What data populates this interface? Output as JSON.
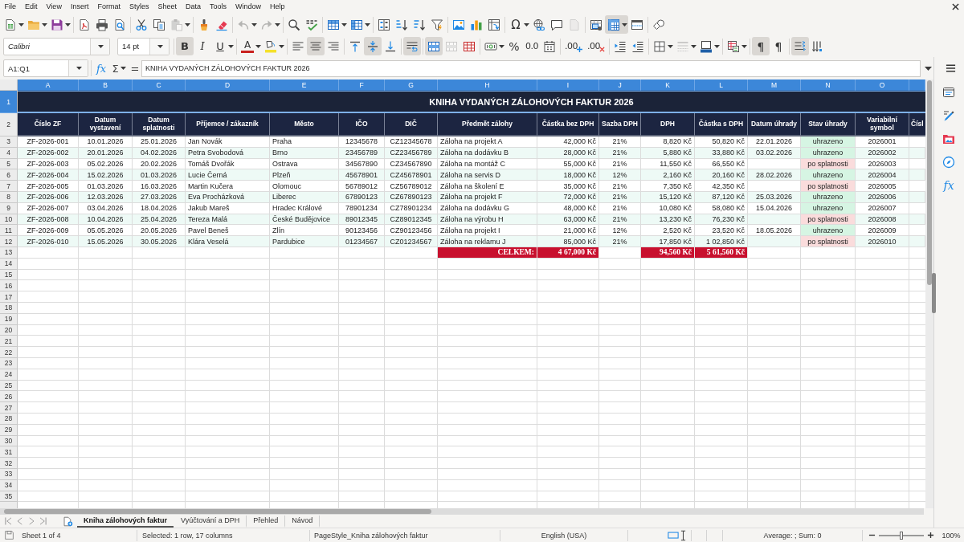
{
  "menu_bar": [
    "File",
    "Edit",
    "View",
    "Insert",
    "Format",
    "Styles",
    "Sheet",
    "Data",
    "Tools",
    "Window",
    "Help"
  ],
  "standard_toolbar": [
    {
      "on": false,
      "disabled": false
    },
    {
      "on": false,
      "disabled": false
    },
    {
      "on": false,
      "disabled": false
    },
    {
      "on": false,
      "disabled": false
    },
    {
      "on": false,
      "disabled": false
    },
    {
      "on": false,
      "disabled": false
    },
    {
      "on": false,
      "disabled": false
    },
    {
      "on": false,
      "disabled": false
    },
    {
      "on": false,
      "disabled": true
    },
    {
      "on": false,
      "disabled": false
    },
    {
      "on": false,
      "disabled": false
    },
    {
      "on": false,
      "disabled": true
    },
    {
      "on": false,
      "disabled": true
    },
    {
      "on": false,
      "disabled": false
    },
    {
      "on": false,
      "disabled": false
    },
    {
      "on": false,
      "disabled": false
    },
    {
      "on": false,
      "disabled": false
    },
    {
      "on": false,
      "disabled": false
    },
    {
      "on": false,
      "disabled": false
    },
    {
      "on": false,
      "disabled": false
    },
    {
      "on": false,
      "disabled": false
    },
    {
      "on": false,
      "disabled": false
    },
    {
      "on": false,
      "disabled": false
    },
    {
      "on": false,
      "disabled": false
    },
    {
      "glyph": "Ω",
      "on": false,
      "disabled": false
    },
    {
      "on": false,
      "disabled": false
    },
    {
      "on": false,
      "disabled": false
    },
    {
      "on": false,
      "disabled": true
    },
    {
      "on": false,
      "disabled": false
    },
    {
      "on": true,
      "disabled": false
    },
    {
      "on": false,
      "disabled": false
    },
    {
      "on": false,
      "disabled": false
    }
  ],
  "formatting_toolbar": {
    "font_name": "Calibri",
    "font_size": "14 pt",
    "buttons": [
      {
        "glyph": "B",
        "on": true,
        "disabled": false
      },
      {
        "glyph": "I",
        "on": false,
        "disabled": false
      },
      {
        "glyph": "U",
        "on": false,
        "disabled": false
      },
      {
        "glyph": "A",
        "on": false,
        "disabled": false
      },
      {
        "on": false,
        "disabled": false
      },
      {
        "on": false,
        "disabled": false
      },
      {
        "on": true,
        "disabled": false
      },
      {
        "on": false,
        "disabled": false
      },
      {
        "on": false,
        "disabled": false
      },
      {
        "on": true,
        "disabled": false
      },
      {
        "on": false,
        "disabled": false
      },
      {
        "on": true,
        "disabled": false
      },
      {
        "on": true,
        "disabled": false
      },
      {
        "on": false,
        "disabled": true
      },
      {
        "on": false,
        "disabled": false
      },
      {
        "on": false,
        "disabled": false
      },
      {
        "glyph": "%",
        "on": false,
        "disabled": false
      },
      {
        "glyph": "0.0",
        "on": false,
        "disabled": false
      },
      {
        "on": false,
        "disabled": false
      },
      {
        "glyph": ".00",
        "on": false,
        "disabled": false
      },
      {
        "glyph": ".00",
        "on": false,
        "disabled": false
      },
      {
        "on": false,
        "disabled": false
      },
      {
        "on": false,
        "disabled": false
      },
      {
        "on": false,
        "disabled": false
      },
      {
        "on": false,
        "disabled": true
      },
      {
        "on": false,
        "disabled": false
      },
      {
        "on": false,
        "disabled": false
      },
      {
        "glyph": "¶",
        "on": true,
        "disabled": false
      },
      {
        "glyph": "¶",
        "on": false,
        "disabled": false
      },
      {
        "on": true,
        "disabled": false
      },
      {
        "on": false,
        "disabled": false
      }
    ]
  },
  "formula_bar": {
    "name_box": "A1:Q1",
    "function_wizard": "fx",
    "sum": "Σ",
    "equals": "=",
    "content": "KNIHA VYDANÝCH ZÁLOHOVÝCH FAKTUR 2026"
  },
  "sidebar": {
    "functions": "fx"
  },
  "sheet": {
    "columns": [
      {
        "letter": "A",
        "selected": true
      },
      {
        "letter": "B",
        "selected": true
      },
      {
        "letter": "C",
        "selected": true
      },
      {
        "letter": "D",
        "selected": true
      },
      {
        "letter": "E",
        "selected": true
      },
      {
        "letter": "F",
        "selected": true
      },
      {
        "letter": "G",
        "selected": true
      },
      {
        "letter": "H",
        "selected": true
      },
      {
        "letter": "I",
        "selected": true
      },
      {
        "letter": "J",
        "selected": true
      },
      {
        "letter": "K",
        "selected": true
      },
      {
        "letter": "L",
        "selected": true
      },
      {
        "letter": "M",
        "selected": true
      },
      {
        "letter": "N",
        "selected": true
      },
      {
        "letter": "O",
        "selected": true
      },
      {
        "selected": true
      }
    ],
    "row_numbers": [
      {
        "number": "1",
        "selected": true
      },
      {
        "number": "2",
        "selected": false
      },
      {
        "number": "3",
        "selected": false
      },
      {
        "number": "4",
        "selected": false
      },
      {
        "number": "5",
        "selected": false
      },
      {
        "number": "6",
        "selected": false
      },
      {
        "number": "7",
        "selected": false
      },
      {
        "number": "8",
        "selected": false
      },
      {
        "number": "9",
        "selected": false
      },
      {
        "number": "10",
        "selected": false
      },
      {
        "number": "11",
        "selected": false
      },
      {
        "number": "12",
        "selected": false
      },
      {
        "number": "13",
        "selected": false
      },
      {
        "number": "14",
        "selected": false
      },
      {
        "number": "15",
        "selected": false
      },
      {
        "number": "16",
        "selected": false
      },
      {
        "number": "17",
        "selected": false
      },
      {
        "number": "18",
        "selected": false
      },
      {
        "number": "19",
        "selected": false
      },
      {
        "number": "20",
        "selected": false
      },
      {
        "number": "21",
        "selected": false
      },
      {
        "number": "22",
        "selected": false
      },
      {
        "number": "23",
        "selected": false
      },
      {
        "number": "24",
        "selected": false
      },
      {
        "number": "25",
        "selected": false
      },
      {
        "number": "26",
        "selected": false
      },
      {
        "number": "27",
        "selected": false
      },
      {
        "number": "28",
        "selected": false
      },
      {
        "number": "29",
        "selected": false
      },
      {
        "number": "30",
        "selected": false
      },
      {
        "number": "31",
        "selected": false
      },
      {
        "number": "32",
        "selected": false
      },
      {
        "number": "33",
        "selected": false
      },
      {
        "number": "34",
        "selected": false
      },
      {
        "number": "35",
        "selected": false
      }
    ],
    "title": "KNIHA VYDANÝCH ZÁLOHOVÝCH FAKTUR 2026",
    "headers": [
      "Číslo ZF",
      "Datum vystavení",
      "Datum splatnosti",
      "Příjemce / zákazník",
      "Město",
      "IČO",
      "DIČ",
      "Předmět zálohy",
      "Částka bez DPH",
      "Sazba DPH",
      "DPH",
      "Částka s DPH",
      "Datum úhrady",
      "Stav úhrady",
      "Variabilní symbol",
      "Čísl"
    ],
    "rows": [
      {
        "cislo_zf": "ZF-2026-001",
        "datum_vystaveni": "10.01.2026",
        "datum_splatnosti": "25.01.2026",
        "prijemce": "Jan Novák",
        "mesto": "Praha",
        "ico": "12345678",
        "dic": "CZ12345678",
        "predmet": "Záloha na projekt A",
        "castka_bez_dph": "42,000 Kč",
        "sazba_dph": "21%",
        "dph": "8,820 Kč",
        "castka_s_dph": "50,820 Kč",
        "datum_uhrady": "22.01.2026",
        "stav_uhrady": {
          "text": "uhrazeno",
          "color": "#d6f5e3"
        },
        "variabilni_symbol": "2026001"
      },
      {
        "cislo_zf": "ZF-2026-002",
        "datum_vystaveni": "20.01.2026",
        "datum_splatnosti": "04.02.2026",
        "prijemce": "Petra Svobodová",
        "mesto": "Brno",
        "ico": "23456789",
        "dic": "CZ23456789",
        "predmet": "Záloha na dodávku B",
        "castka_bez_dph": "28,000 Kč",
        "sazba_dph": "21%",
        "dph": "5,880 Kč",
        "castka_s_dph": "33,880 Kč",
        "datum_uhrady": "03.02.2026",
        "stav_uhrady": {
          "text": "uhrazeno",
          "color": "#d6f5e3"
        },
        "variabilni_symbol": "2026002"
      },
      {
        "cislo_zf": "ZF-2026-003",
        "datum_vystaveni": "05.02.2026",
        "datum_splatnosti": "20.02.2026",
        "prijemce": "Tomáš Dvořák",
        "mesto": "Ostrava",
        "ico": "34567890",
        "dic": "CZ34567890",
        "predmet": "Záloha na montáž C",
        "castka_bez_dph": "55,000 Kč",
        "sazba_dph": "21%",
        "dph": "11,550 Kč",
        "castka_s_dph": "66,550 Kč",
        "stav_uhrady": {
          "text": "po splatnosti",
          "color": "#fadcdc"
        },
        "variabilni_symbol": "2026003"
      },
      {
        "cislo_zf": "ZF-2026-004",
        "datum_vystaveni": "15.02.2026",
        "datum_splatnosti": "01.03.2026",
        "prijemce": "Lucie Černá",
        "mesto": "Plzeň",
        "ico": "45678901",
        "dic": "CZ45678901",
        "predmet": "Záloha na servis D",
        "castka_bez_dph": "18,000 Kč",
        "sazba_dph": "12%",
        "dph": "2,160 Kč",
        "castka_s_dph": "20,160 Kč",
        "datum_uhrady": "28.02.2026",
        "stav_uhrady": {
          "text": "uhrazeno",
          "color": "#d6f5e3"
        },
        "variabilni_symbol": "2026004"
      },
      {
        "cislo_zf": "ZF-2026-005",
        "datum_vystaveni": "01.03.2026",
        "datum_splatnosti": "16.03.2026",
        "prijemce": "Martin Kučera",
        "mesto": "Olomouc",
        "ico": "56789012",
        "dic": "CZ56789012",
        "predmet": "Záloha na školení E",
        "castka_bez_dph": "35,000 Kč",
        "sazba_dph": "21%",
        "dph": "7,350 Kč",
        "castka_s_dph": "42,350 Kč",
        "stav_uhrady": {
          "text": "po splatnosti",
          "color": "#fadcdc"
        },
        "variabilni_symbol": "2026005"
      },
      {
        "cislo_zf": "ZF-2026-006",
        "datum_vystaveni": "12.03.2026",
        "datum_splatnosti": "27.03.2026",
        "prijemce": "Eva Procházková",
        "mesto": "Liberec",
        "ico": "67890123",
        "dic": "CZ67890123",
        "predmet": "Záloha na projekt F",
        "castka_bez_dph": "72,000 Kč",
        "sazba_dph": "21%",
        "dph": "15,120 Kč",
        "castka_s_dph": "87,120 Kč",
        "datum_uhrady": "25.03.2026",
        "stav_uhrady": {
          "text": "uhrazeno",
          "color": "#d6f5e3"
        },
        "variabilni_symbol": "2026006"
      },
      {
        "cislo_zf": "ZF-2026-007",
        "datum_vystaveni": "03.04.2026",
        "datum_splatnosti": "18.04.2026",
        "prijemce": "Jakub Mareš",
        "mesto": "Hradec Králové",
        "ico": "78901234",
        "dic": "CZ78901234",
        "predmet": "Záloha na dodávku G",
        "castka_bez_dph": "48,000 Kč",
        "sazba_dph": "21%",
        "dph": "10,080 Kč",
        "castka_s_dph": "58,080 Kč",
        "datum_uhrady": "15.04.2026",
        "stav_uhrady": {
          "text": "uhrazeno",
          "color": "#d6f5e3"
        },
        "variabilni_symbol": "2026007"
      },
      {
        "cislo_zf": "ZF-2026-008",
        "datum_vystaveni": "10.04.2026",
        "datum_splatnosti": "25.04.2026",
        "prijemce": "Tereza Malá",
        "mesto": "České Budějovice",
        "ico": "89012345",
        "dic": "CZ89012345",
        "predmet": "Záloha na výrobu H",
        "castka_bez_dph": "63,000 Kč",
        "sazba_dph": "21%",
        "dph": "13,230 Kč",
        "castka_s_dph": "76,230 Kč",
        "stav_uhrady": {
          "text": "po splatnosti",
          "color": "#fadcdc"
        },
        "variabilni_symbol": "2026008"
      },
      {
        "cislo_zf": "ZF-2026-009",
        "datum_vystaveni": "05.05.2026",
        "datum_splatnosti": "20.05.2026",
        "prijemce": "Pavel Beneš",
        "mesto": "Zlín",
        "ico": "90123456",
        "dic": "CZ90123456",
        "predmet": "Záloha na projekt I",
        "castka_bez_dph": "21,000 Kč",
        "sazba_dph": "12%",
        "dph": "2,520 Kč",
        "castka_s_dph": "23,520 Kč",
        "datum_uhrady": "18.05.2026",
        "stav_uhrady": {
          "text": "uhrazeno",
          "color": "#d6f5e3"
        },
        "variabilni_symbol": "2026009"
      },
      {
        "cislo_zf": "ZF-2026-010",
        "datum_vystaveni": "15.05.2026",
        "datum_splatnosti": "30.05.2026",
        "prijemce": "Klára Veselá",
        "mesto": "Pardubice",
        "ico": "01234567",
        "dic": "CZ01234567",
        "predmet": "Záloha na reklamu J",
        "castka_bez_dph": "85,000 Kč",
        "sazba_dph": "21%",
        "dph": "17,850 Kč",
        "castka_s_dph": "1 02,850 Kč",
        "stav_uhrady": {
          "text": "po splatnosti",
          "color": "#fadcdc"
        },
        "variabilni_symbol": "2026010"
      }
    ],
    "totals": {
      "label": "CELKEM:",
      "castka_bez_dph": "4 67,000 Kč",
      "dph": "94,560 Kč",
      "castka_s_dph": "5 61,560 Kč"
    }
  },
  "sheet_tabs": [
    {
      "label": "Kniha zálohových faktur",
      "selected": true
    },
    {
      "label": "Vyúčtování a DPH",
      "selected": false
    },
    {
      "label": "Přehled",
      "selected": false
    },
    {
      "label": "Návod",
      "selected": false
    }
  ],
  "status_bar": {
    "sheet": "Sheet 1 of 4",
    "selection": "Selected: 1 row, 17 columns",
    "page_style": "PageStyle_Kniha zálohových faktur",
    "language": "English (USA)",
    "summary": "Average: ; Sum: 0",
    "zoom_slider": {
      "level": 0.5
    },
    "zoom": "100%"
  }
}
